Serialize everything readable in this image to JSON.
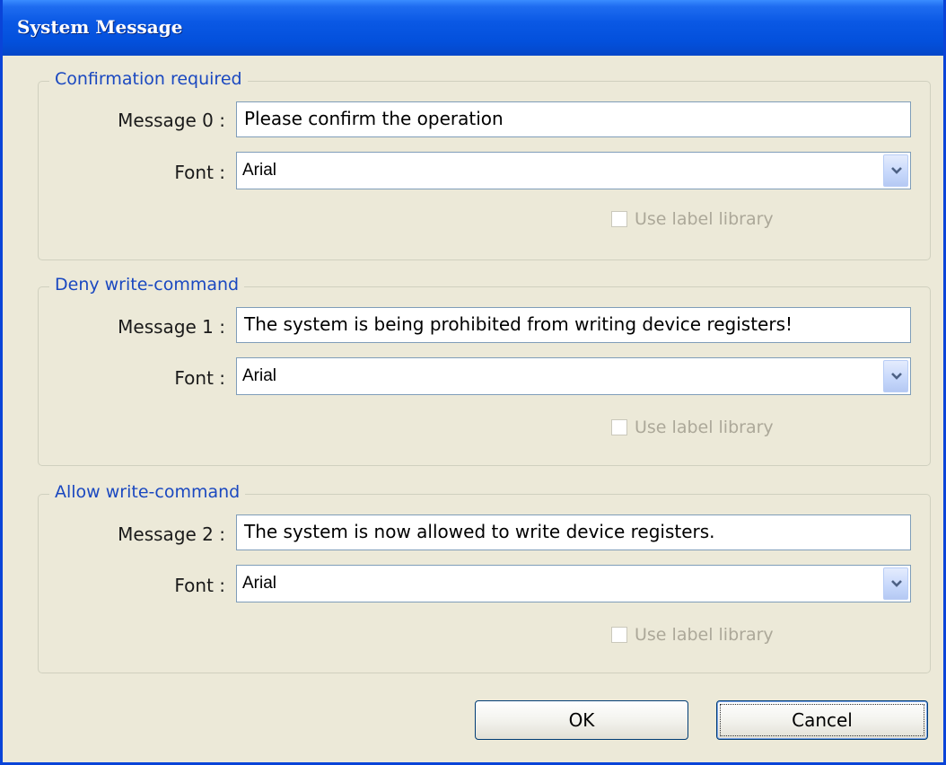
{
  "window": {
    "title": "System Message"
  },
  "groups": [
    {
      "legend": "Confirmation required",
      "message_label": "Message 0 :",
      "message_value": "Please confirm the operation",
      "font_label": "Font :",
      "font_value": "Arial",
      "checkbox_label": "Use label library"
    },
    {
      "legend": "Deny write-command",
      "message_label": "Message 1 :",
      "message_value": "The system is being prohibited from writing device registers!",
      "font_label": "Font :",
      "font_value": "Arial",
      "checkbox_label": "Use label library"
    },
    {
      "legend": "Allow write-command",
      "message_label": "Message 2 :",
      "message_value": "The system is now allowed to write device registers.",
      "font_label": "Font :",
      "font_value": "Arial",
      "checkbox_label": "Use label library"
    }
  ],
  "buttons": {
    "ok": "OK",
    "cancel": "Cancel"
  },
  "icons": {
    "dropdown": "chevron-down-icon"
  },
  "colors": {
    "title_bar": "#0450dc",
    "legend_text": "#1a48c0",
    "disabled_text": "#aca899"
  }
}
